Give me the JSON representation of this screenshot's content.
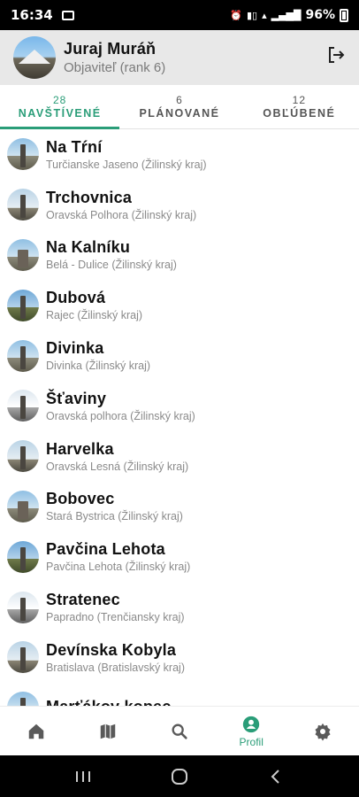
{
  "status_bar": {
    "time": "16:34",
    "battery": "96%",
    "indicators": [
      "alarm-icon",
      "volte-icon",
      "wifi-icon",
      "signal-icon"
    ]
  },
  "user": {
    "name": "Juraj Muráň",
    "rank": "Objaviteľ (rank 6)",
    "avatar_icon": "avatar-photo"
  },
  "tabs": [
    {
      "count": "28",
      "label": "NAVŠTÍVENÉ",
      "active": true
    },
    {
      "count": "6",
      "label": "PLÁNOVANÉ",
      "active": false
    },
    {
      "count": "12",
      "label": "OBĽÚBENÉ",
      "active": false
    }
  ],
  "places": [
    {
      "name": "Na Tŕní",
      "location": "Turčianske Jaseno (Žilinský kraj)"
    },
    {
      "name": "Trchovnica",
      "location": "Oravská Polhora (Žilinský kraj)"
    },
    {
      "name": "Na Kalníku",
      "location": "Belá - Dulice (Žilinský kraj)"
    },
    {
      "name": "Dubová",
      "location": "Rajec (Žilinský kraj)"
    },
    {
      "name": "Divinka",
      "location": "Divinka (Žilinský kraj)"
    },
    {
      "name": "Šťaviny",
      "location": "Oravská polhora (Žilinský kraj)"
    },
    {
      "name": "Harvelka",
      "location": "Oravská Lesná (Žilinský kraj)"
    },
    {
      "name": "Bobovec",
      "location": "Stará Bystrica (Žilinský kraj)"
    },
    {
      "name": "Pavčina Lehota",
      "location": "Pavčina Lehota (Žilinský kraj)"
    },
    {
      "name": "Stratenec",
      "location": "Papradno (Trenčiansky kraj)"
    },
    {
      "name": "Devínska Kobyla",
      "location": "Bratislava (Bratislavský kraj)"
    },
    {
      "name": "Marťákov kopec",
      "location": ""
    }
  ],
  "bottom_nav": {
    "items": [
      {
        "icon": "home-icon",
        "label": ""
      },
      {
        "icon": "map-icon",
        "label": ""
      },
      {
        "icon": "search-icon",
        "label": ""
      },
      {
        "icon": "profile-icon",
        "label": "Profil"
      },
      {
        "icon": "gear-icon",
        "label": ""
      }
    ],
    "active_index": 3
  },
  "colors": {
    "accent": "#2a9d78",
    "header_bg": "#e8e8e8",
    "inactive_icon": "#5a5a5a"
  }
}
